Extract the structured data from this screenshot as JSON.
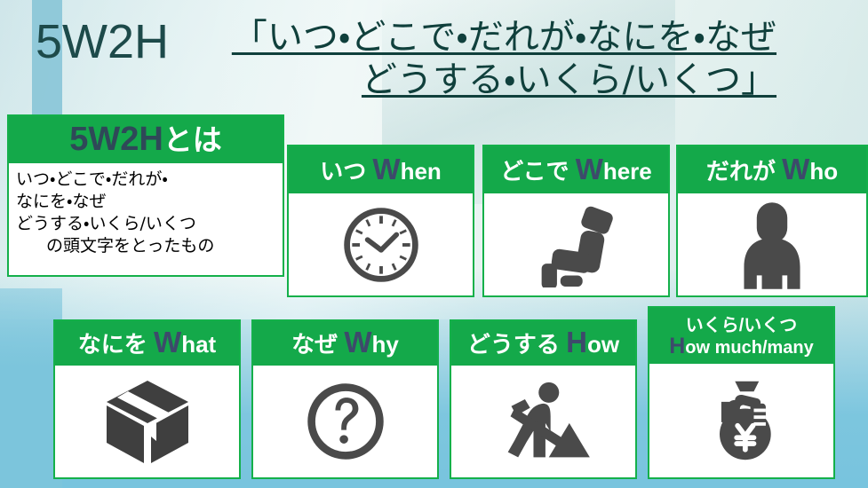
{
  "slide": {
    "title_main": "5W2H",
    "title_sub_line1": "「いつ・どこで・だれが・なにを・なぜ",
    "title_sub_line2": "どうする・いくら/いくつ」",
    "accent_green": "#14a94a",
    "accent_green_border": "#14b04a",
    "accent_navy": "#3d4a6b",
    "title_color": "#1d4a4a",
    "icon_color": "#4a4a4a",
    "background_teal": "#7cc5dc"
  },
  "definition": {
    "head_jp": "5W2H",
    "head_suffix": "とは",
    "lines": [
      "いつ・どこで・だれが・",
      "なにを・なぜ",
      "どうする・いくら/いくつ",
      "の頭文字をとったもの"
    ]
  },
  "cards": [
    {
      "id": "when",
      "head_jp": "いつ ",
      "head_initial": "W",
      "head_rest": "hen",
      "icon": "clock-icon"
    },
    {
      "id": "where",
      "head_jp": "どこで ",
      "head_initial": "W",
      "head_rest": "here",
      "icon": "seat-icon"
    },
    {
      "id": "who",
      "head_jp": "だれが ",
      "head_initial": "W",
      "head_rest": "ho",
      "icon": "person-icon"
    },
    {
      "id": "what",
      "head_jp": "なにを ",
      "head_initial": "W",
      "head_rest": "hat",
      "icon": "box-icon"
    },
    {
      "id": "why",
      "head_jp": "なぜ ",
      "head_initial": "W",
      "head_rest": "hy",
      "icon": "question-mark-icon"
    },
    {
      "id": "how",
      "head_jp": "どうする ",
      "head_initial": "H",
      "head_rest": "ow",
      "icon": "worker-digging-icon"
    },
    {
      "id": "howmuch",
      "head_line1": "いくら/いくつ",
      "head_initial": "H",
      "head_rest": "ow much/many",
      "icon": "money-bag-yen-icon"
    }
  ]
}
